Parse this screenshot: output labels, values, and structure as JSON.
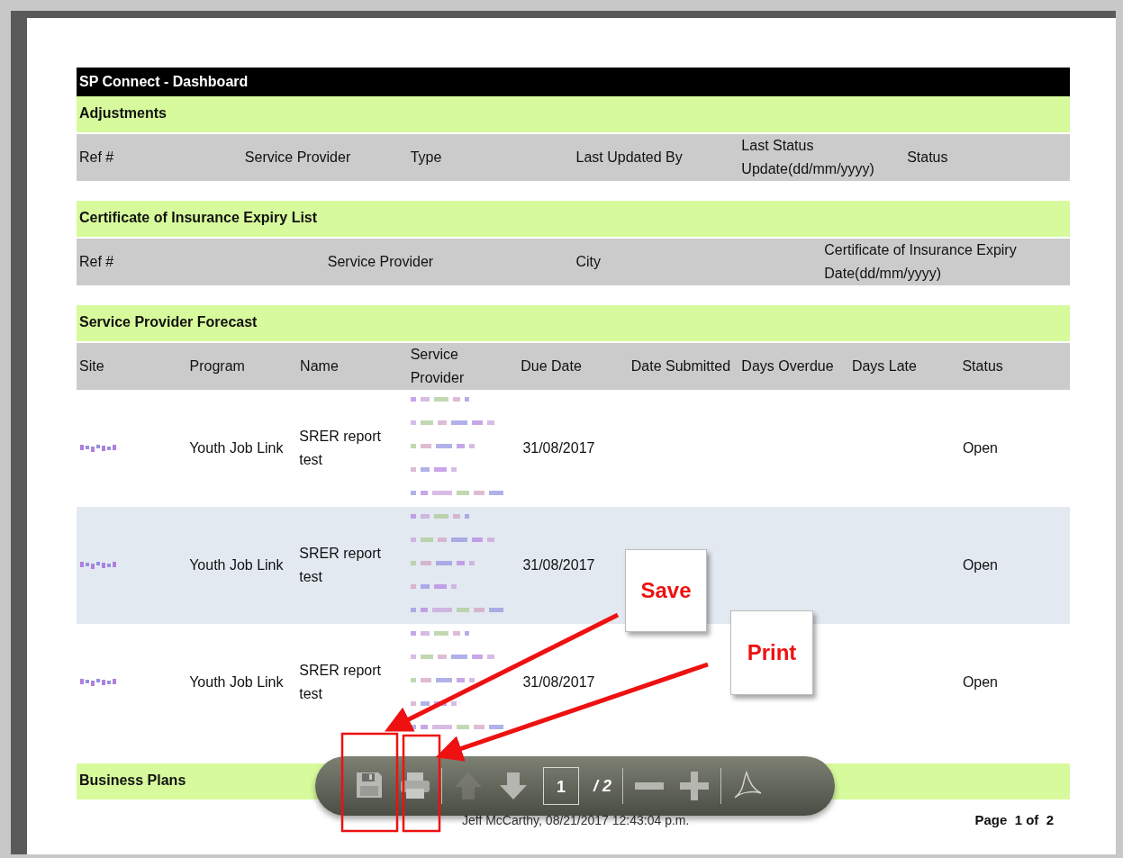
{
  "document": {
    "title": "SP Connect - Dashboard",
    "sections": [
      {
        "heading": "Adjustments",
        "columns": [
          "Ref #",
          "Service Provider",
          "Type",
          "Last Updated By",
          "Last Status Update(dd/mm/yyyy)",
          "Status"
        ]
      },
      {
        "heading": "Certificate of Insurance Expiry List",
        "columns": [
          "Ref #",
          "Service Provider",
          "City",
          "Certificate of Insurance Expiry Date(dd/mm/yyyy)"
        ]
      },
      {
        "heading": "Service Provider Forecast",
        "columns": [
          "Site",
          "Program",
          "Name",
          "Service Provider",
          "Due Date",
          "Date Submitted",
          "Days Overdue",
          "Days Late",
          "Status"
        ],
        "rows": [
          {
            "program": "Youth Job Link",
            "name": "SRER report test",
            "due_date": "31/08/2017",
            "status": "Open"
          },
          {
            "program": "Youth Job Link",
            "name": "SRER report test",
            "due_date": "31/08/2017",
            "status": "Open"
          },
          {
            "program": "Youth Job Link",
            "name": "SRER report test",
            "due_date": "31/08/2017",
            "status": "Open"
          }
        ]
      },
      {
        "heading": "Business Plans"
      }
    ],
    "footer_author": "Jeff McCarthy, 08/21/2017 12:43:04 p.m.",
    "footer_page": "Page  1 of  2"
  },
  "viewer_toolbar": {
    "groups": [
      [
        {
          "kind": "save",
          "disabled": false
        },
        {
          "kind": "print",
          "disabled": false
        }
      ],
      [
        {
          "kind": "previous",
          "disabled": true
        },
        {
          "kind": "next",
          "disabled": false
        },
        {
          "kind": "page",
          "value": "1",
          "total": "/ 2"
        }
      ],
      [
        {
          "kind": "zoom_out",
          "disabled": false
        },
        {
          "kind": "zoom_in",
          "disabled": false
        }
      ],
      [
        {
          "kind": "logo",
          "disabled": false
        }
      ]
    ]
  },
  "annotations": [
    {
      "label": "Save"
    },
    {
      "label": "Print"
    }
  ]
}
